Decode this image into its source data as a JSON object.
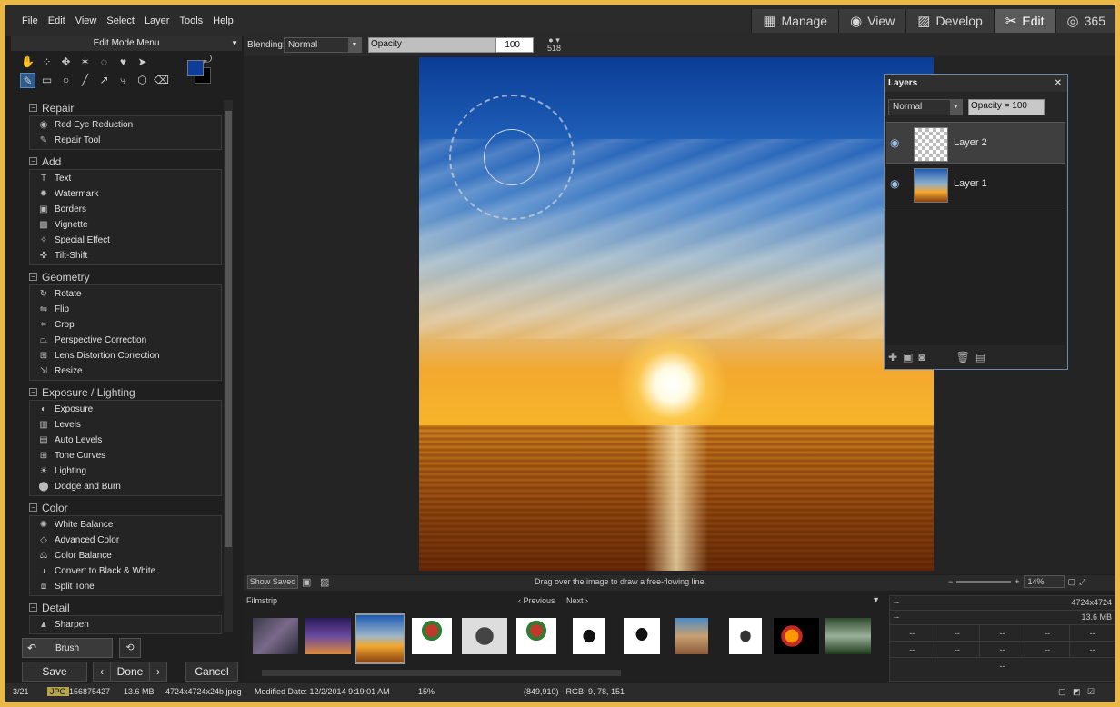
{
  "menu": [
    "File",
    "Edit",
    "View",
    "Select",
    "Layer",
    "Tools",
    "Help"
  ],
  "modes": [
    {
      "label": "Manage",
      "icon": "grid-icon"
    },
    {
      "label": "View",
      "icon": "eye-icon"
    },
    {
      "label": "Develop",
      "icon": "image-icon"
    },
    {
      "label": "Edit",
      "icon": "tools-icon",
      "active": true
    },
    {
      "label": "365",
      "icon": "365-icon"
    }
  ],
  "left": {
    "menu_title": "Edit Mode Menu",
    "sections": [
      {
        "title": "Repair",
        "items": [
          "Red Eye Reduction",
          "Repair Tool"
        ]
      },
      {
        "title": "Add",
        "items": [
          "Text",
          "Watermark",
          "Borders",
          "Vignette",
          "Special Effect",
          "Tilt-Shift"
        ]
      },
      {
        "title": "Geometry",
        "items": [
          "Rotate",
          "Flip",
          "Crop",
          "Perspective Correction",
          "Lens Distortion Correction",
          "Resize"
        ]
      },
      {
        "title": "Exposure / Lighting",
        "items": [
          "Exposure",
          "Levels",
          "Auto Levels",
          "Tone Curves",
          "Lighting",
          "Dodge and Burn"
        ]
      },
      {
        "title": "Color",
        "items": [
          "White Balance",
          "Advanced Color",
          "Color Balance",
          "Convert to Black & White",
          "Split Tone"
        ]
      },
      {
        "title": "Detail",
        "items": [
          "Sharpen"
        ]
      }
    ],
    "brush_label": "Brush",
    "save": "Save",
    "done": "Done",
    "cancel": "Cancel",
    "fg_color": "#0b3d9a",
    "bg_color": "#000000"
  },
  "options": {
    "blending_label": "Blending:",
    "blending_value": "Normal",
    "opacity_label": "Opacity",
    "opacity_value": "100",
    "brush_size": "518"
  },
  "layers": {
    "title": "Layers",
    "blend": "Normal",
    "opacity": "Opacity = 100",
    "items": [
      {
        "name": "Layer 2",
        "selected": true
      },
      {
        "name": "Layer 1",
        "selected": false
      }
    ]
  },
  "statusline": {
    "show_saved": "Show Saved",
    "hint": "Drag over the image to draw a free-flowing line.",
    "zoom": "14%"
  },
  "filmstrip": {
    "title": "Filmstrip",
    "previous": "Previous",
    "next": "Next"
  },
  "info": {
    "dim": "4724x4724",
    "size": "13.6 MB",
    "empty": "--"
  },
  "status": {
    "index": "3/21",
    "format": "JPG",
    "id": "156875427",
    "size": "13.6 MB",
    "desc": "4724x4724x24b jpeg",
    "modified": "Modified Date: 12/2/2014 9:19:01 AM",
    "zoom": "15%",
    "pixel": "(849,910) - RGB: 9, 78, 151"
  }
}
